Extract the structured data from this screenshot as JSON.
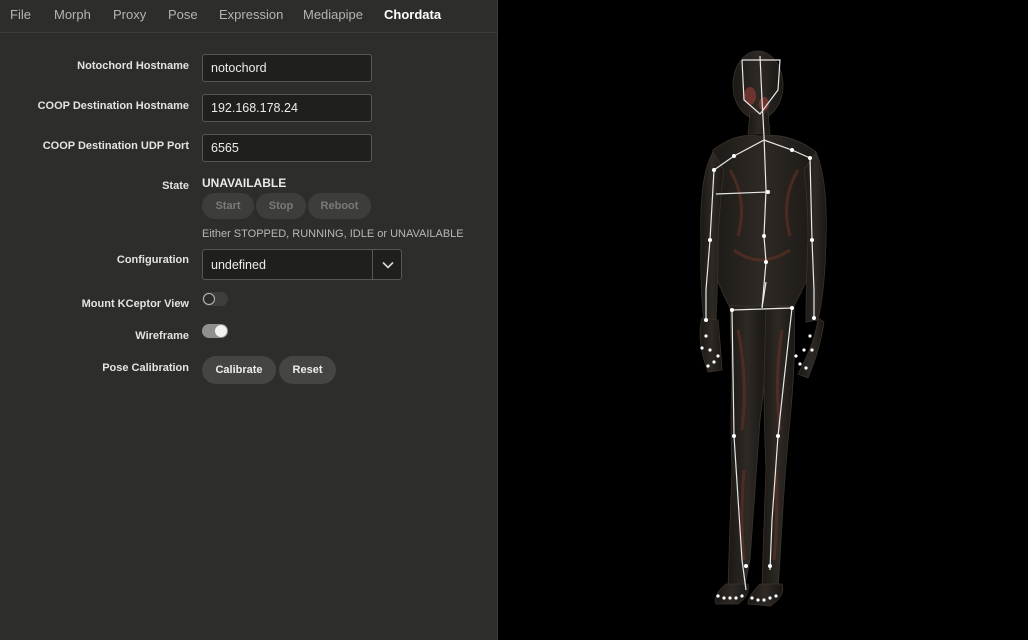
{
  "menu": {
    "items": [
      "File",
      "Morph",
      "Proxy",
      "Pose",
      "Expression",
      "Mediapipe",
      "Chordata"
    ],
    "active": "Chordata"
  },
  "form": {
    "notochord_hostname": {
      "label": "Notochord Hostname",
      "value": "notochord"
    },
    "coop_hostname": {
      "label": "COOP Destination Hostname",
      "value": "192.168.178.24"
    },
    "coop_udp_port": {
      "label": "COOP Destination UDP Port",
      "value": "6565"
    },
    "state": {
      "label": "State",
      "value": "UNAVAILABLE",
      "buttons": {
        "start": "Start",
        "stop": "Stop",
        "reboot": "Reboot"
      },
      "hint": "Either STOPPED, RUNNING, IDLE or UNAVAILABLE"
    },
    "configuration": {
      "label": "Configuration",
      "value": "undefined"
    },
    "mount_kceptor_view": {
      "label": "Mount KCeptor View",
      "enabled": false
    },
    "wireframe": {
      "label": "Wireframe",
      "enabled": true
    },
    "pose_calibration": {
      "label": "Pose Calibration",
      "calibrate": "Calibrate",
      "reset": "Reset"
    }
  },
  "colors": {
    "panel_bg": "#2d2e2b",
    "viewport_bg": "#000000",
    "skeleton": "#e8e8e8",
    "body_shade": "#2a2622",
    "muscle_accent": "#7a3b2a"
  }
}
